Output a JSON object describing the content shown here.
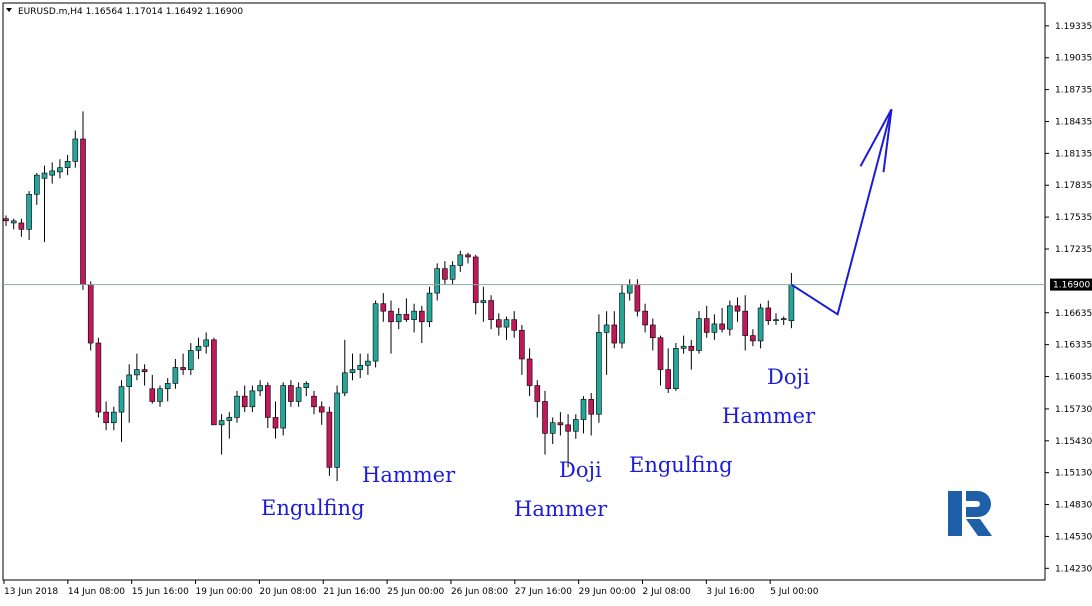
{
  "symbol_info": "EURUSD.m,H4  1.16564 1.17014 1.16492 1.16900",
  "current_price_label": "1.16900",
  "colors": {
    "bull": "#26a69a",
    "bear": "#c2185b",
    "line": "#1c1cd8",
    "logo": "#1f5fa8"
  },
  "logo_icon": "roboforex-logo-icon",
  "chart_data": {
    "type": "candlestick",
    "title": "EURUSD.m,H4",
    "xlabel": "",
    "ylabel": "",
    "ylim": [
      1.1412,
      1.1955
    ],
    "current_price": 1.169,
    "y_ticks": [
      "1.19335",
      "1.19035",
      "1.18735",
      "1.18435",
      "1.18135",
      "1.17835",
      "1.17535",
      "1.17235",
      "1.16635",
      "1.16335",
      "1.16035",
      "1.15730",
      "1.15430",
      "1.15130",
      "1.14830",
      "1.14530",
      "1.14230"
    ],
    "x_ticks": [
      "13 Jun 2018",
      "14 Jun 08:00",
      "15 Jun 16:00",
      "19 Jun 00:00",
      "20 Jun 08:00",
      "21 Jun 16:00",
      "25 Jun 00:00",
      "26 Jun 08:00",
      "27 Jun 16:00",
      "29 Jun 00:00",
      "2 Jul 08:00",
      "3 Jul 16:00",
      "5 Jul 00:00"
    ],
    "candles": [
      {
        "o": 1.1752,
        "h": 1.1755,
        "l": 1.1745,
        "c": 1.175
      },
      {
        "o": 1.1748,
        "h": 1.1752,
        "l": 1.1742,
        "c": 1.175
      },
      {
        "o": 1.1748,
        "h": 1.1752,
        "l": 1.1735,
        "c": 1.1742
      },
      {
        "o": 1.1742,
        "h": 1.1778,
        "l": 1.1732,
        "c": 1.1775
      },
      {
        "o": 1.1775,
        "h": 1.1795,
        "l": 1.1765,
        "c": 1.1793
      },
      {
        "o": 1.179,
        "h": 1.1802,
        "l": 1.173,
        "c": 1.1795
      },
      {
        "o": 1.1793,
        "h": 1.1805,
        "l": 1.1785,
        "c": 1.1797
      },
      {
        "o": 1.1796,
        "h": 1.1808,
        "l": 1.179,
        "c": 1.18
      },
      {
        "o": 1.18,
        "h": 1.1812,
        "l": 1.1793,
        "c": 1.1806
      },
      {
        "o": 1.1806,
        "h": 1.1835,
        "l": 1.18,
        "c": 1.1827
      },
      {
        "o": 1.1827,
        "h": 1.1853,
        "l": 1.1685,
        "c": 1.169
      },
      {
        "o": 1.169,
        "h": 1.1693,
        "l": 1.1628,
        "c": 1.1635
      },
      {
        "o": 1.1635,
        "h": 1.164,
        "l": 1.1565,
        "c": 1.157
      },
      {
        "o": 1.157,
        "h": 1.158,
        "l": 1.1553,
        "c": 1.156
      },
      {
        "o": 1.156,
        "h": 1.1575,
        "l": 1.1553,
        "c": 1.157
      },
      {
        "o": 1.157,
        "h": 1.16,
        "l": 1.1542,
        "c": 1.1594
      },
      {
        "o": 1.1594,
        "h": 1.1615,
        "l": 1.156,
        "c": 1.1605
      },
      {
        "o": 1.1605,
        "h": 1.1625,
        "l": 1.16,
        "c": 1.161
      },
      {
        "o": 1.161,
        "h": 1.1615,
        "l": 1.1595,
        "c": 1.1608
      },
      {
        "o": 1.1592,
        "h": 1.1605,
        "l": 1.1578,
        "c": 1.158
      },
      {
        "o": 1.158,
        "h": 1.1595,
        "l": 1.1575,
        "c": 1.1592
      },
      {
        "o": 1.1592,
        "h": 1.1602,
        "l": 1.158,
        "c": 1.1597
      },
      {
        "o": 1.1597,
        "h": 1.162,
        "l": 1.1592,
        "c": 1.1612
      },
      {
        "o": 1.1612,
        "h": 1.1625,
        "l": 1.1605,
        "c": 1.161
      },
      {
        "o": 1.161,
        "h": 1.1635,
        "l": 1.1605,
        "c": 1.1628
      },
      {
        "o": 1.1628,
        "h": 1.164,
        "l": 1.162,
        "c": 1.1632
      },
      {
        "o": 1.1632,
        "h": 1.1645,
        "l": 1.1625,
        "c": 1.1638
      },
      {
        "o": 1.1638,
        "h": 1.164,
        "l": 1.1565,
        "c": 1.1558
      },
      {
        "o": 1.1558,
        "h": 1.1568,
        "l": 1.153,
        "c": 1.1562
      },
      {
        "o": 1.1562,
        "h": 1.157,
        "l": 1.1545,
        "c": 1.1565
      },
      {
        "o": 1.1565,
        "h": 1.159,
        "l": 1.156,
        "c": 1.1585
      },
      {
        "o": 1.1585,
        "h": 1.1595,
        "l": 1.157,
        "c": 1.1575
      },
      {
        "o": 1.1575,
        "h": 1.1595,
        "l": 1.157,
        "c": 1.159
      },
      {
        "o": 1.159,
        "h": 1.16,
        "l": 1.1585,
        "c": 1.1595
      },
      {
        "o": 1.1595,
        "h": 1.1598,
        "l": 1.1555,
        "c": 1.1565
      },
      {
        "o": 1.1565,
        "h": 1.158,
        "l": 1.1545,
        "c": 1.1555
      },
      {
        "o": 1.1555,
        "h": 1.1598,
        "l": 1.1548,
        "c": 1.1595
      },
      {
        "o": 1.1595,
        "h": 1.16,
        "l": 1.1575,
        "c": 1.158
      },
      {
        "o": 1.158,
        "h": 1.1598,
        "l": 1.1575,
        "c": 1.1593
      },
      {
        "o": 1.1593,
        "h": 1.1599,
        "l": 1.1585,
        "c": 1.1597
      },
      {
        "o": 1.1585,
        "h": 1.159,
        "l": 1.1568,
        "c": 1.1575
      },
      {
        "o": 1.1575,
        "h": 1.158,
        "l": 1.1558,
        "c": 1.157
      },
      {
        "o": 1.157,
        "h": 1.1575,
        "l": 1.151,
        "c": 1.1518
      },
      {
        "o": 1.1518,
        "h": 1.1595,
        "l": 1.1505,
        "c": 1.1588
      },
      {
        "o": 1.1588,
        "h": 1.1638,
        "l": 1.1585,
        "c": 1.1607
      },
      {
        "o": 1.1607,
        "h": 1.1625,
        "l": 1.16,
        "c": 1.161
      },
      {
        "o": 1.161,
        "h": 1.1625,
        "l": 1.1602,
        "c": 1.1614
      },
      {
        "o": 1.1614,
        "h": 1.1625,
        "l": 1.1605,
        "c": 1.1618
      },
      {
        "o": 1.1618,
        "h": 1.1675,
        "l": 1.1612,
        "c": 1.1672
      },
      {
        "o": 1.1672,
        "h": 1.1682,
        "l": 1.1655,
        "c": 1.1665
      },
      {
        "o": 1.1665,
        "h": 1.1675,
        "l": 1.1625,
        "c": 1.1655
      },
      {
        "o": 1.1655,
        "h": 1.1668,
        "l": 1.1648,
        "c": 1.1662
      },
      {
        "o": 1.1662,
        "h": 1.1677,
        "l": 1.1655,
        "c": 1.1657
      },
      {
        "o": 1.1657,
        "h": 1.1672,
        "l": 1.1645,
        "c": 1.1665
      },
      {
        "o": 1.1665,
        "h": 1.167,
        "l": 1.1635,
        "c": 1.1655
      },
      {
        "o": 1.1655,
        "h": 1.1688,
        "l": 1.165,
        "c": 1.1682
      },
      {
        "o": 1.1682,
        "h": 1.171,
        "l": 1.1675,
        "c": 1.1705
      },
      {
        "o": 1.1705,
        "h": 1.1712,
        "l": 1.169,
        "c": 1.1695
      },
      {
        "o": 1.1695,
        "h": 1.1712,
        "l": 1.169,
        "c": 1.1708
      },
      {
        "o": 1.1708,
        "h": 1.1722,
        "l": 1.1702,
        "c": 1.1718
      },
      {
        "o": 1.1718,
        "h": 1.172,
        "l": 1.171,
        "c": 1.1716
      },
      {
        "o": 1.1716,
        "h": 1.1718,
        "l": 1.1662,
        "c": 1.1673
      },
      {
        "o": 1.1673,
        "h": 1.1688,
        "l": 1.1655,
        "c": 1.1675
      },
      {
        "o": 1.1675,
        "h": 1.168,
        "l": 1.1648,
        "c": 1.1657
      },
      {
        "o": 1.1657,
        "h": 1.1663,
        "l": 1.1642,
        "c": 1.165
      },
      {
        "o": 1.165,
        "h": 1.166,
        "l": 1.1638,
        "c": 1.1657
      },
      {
        "o": 1.1657,
        "h": 1.1665,
        "l": 1.164,
        "c": 1.1647
      },
      {
        "o": 1.1647,
        "h": 1.1652,
        "l": 1.1605,
        "c": 1.162
      },
      {
        "o": 1.162,
        "h": 1.163,
        "l": 1.1585,
        "c": 1.1595
      },
      {
        "o": 1.1595,
        "h": 1.16,
        "l": 1.1565,
        "c": 1.158
      },
      {
        "o": 1.158,
        "h": 1.159,
        "l": 1.153,
        "c": 1.155
      },
      {
        "o": 1.155,
        "h": 1.1565,
        "l": 1.154,
        "c": 1.156
      },
      {
        "o": 1.156,
        "h": 1.157,
        "l": 1.1548,
        "c": 1.1558
      },
      {
        "o": 1.1558,
        "h": 1.1568,
        "l": 1.1518,
        "c": 1.1552
      },
      {
        "o": 1.1552,
        "h": 1.1568,
        "l": 1.1545,
        "c": 1.1563
      },
      {
        "o": 1.1563,
        "h": 1.1585,
        "l": 1.155,
        "c": 1.1582
      },
      {
        "o": 1.1582,
        "h": 1.1588,
        "l": 1.1548,
        "c": 1.1568
      },
      {
        "o": 1.1568,
        "h": 1.1662,
        "l": 1.156,
        "c": 1.1645
      },
      {
        "o": 1.1645,
        "h": 1.1665,
        "l": 1.1605,
        "c": 1.1652
      },
      {
        "o": 1.1652,
        "h": 1.1665,
        "l": 1.163,
        "c": 1.1635
      },
      {
        "o": 1.1635,
        "h": 1.169,
        "l": 1.163,
        "c": 1.1682
      },
      {
        "o": 1.1682,
        "h": 1.1695,
        "l": 1.1675,
        "c": 1.169
      },
      {
        "o": 1.169,
        "h": 1.1695,
        "l": 1.166,
        "c": 1.1665
      },
      {
        "o": 1.1665,
        "h": 1.1672,
        "l": 1.1645,
        "c": 1.1652
      },
      {
        "o": 1.1652,
        "h": 1.1658,
        "l": 1.1628,
        "c": 1.164
      },
      {
        "o": 1.164,
        "h": 1.1642,
        "l": 1.1595,
        "c": 1.161
      },
      {
        "o": 1.161,
        "h": 1.163,
        "l": 1.1588,
        "c": 1.1592
      },
      {
        "o": 1.1592,
        "h": 1.1635,
        "l": 1.159,
        "c": 1.163
      },
      {
        "o": 1.163,
        "h": 1.1642,
        "l": 1.1625,
        "c": 1.1632
      },
      {
        "o": 1.1632,
        "h": 1.1638,
        "l": 1.161,
        "c": 1.1628
      },
      {
        "o": 1.1628,
        "h": 1.1665,
        "l": 1.1625,
        "c": 1.1658
      },
      {
        "o": 1.1658,
        "h": 1.167,
        "l": 1.164,
        "c": 1.1645
      },
      {
        "o": 1.1645,
        "h": 1.1662,
        "l": 1.1638,
        "c": 1.1653
      },
      {
        "o": 1.1653,
        "h": 1.1668,
        "l": 1.1645,
        "c": 1.1648
      },
      {
        "o": 1.1648,
        "h": 1.1675,
        "l": 1.1642,
        "c": 1.167
      },
      {
        "o": 1.167,
        "h": 1.1678,
        "l": 1.1655,
        "c": 1.1665
      },
      {
        "o": 1.1665,
        "h": 1.168,
        "l": 1.1628,
        "c": 1.1642
      },
      {
        "o": 1.1642,
        "h": 1.1648,
        "l": 1.1632,
        "c": 1.1637
      },
      {
        "o": 1.1637,
        "h": 1.1672,
        "l": 1.163,
        "c": 1.1668
      },
      {
        "o": 1.1668,
        "h": 1.1675,
        "l": 1.1652,
        "c": 1.1656
      },
      {
        "o": 1.1656,
        "h": 1.1663,
        "l": 1.1652,
        "c": 1.1657
      },
      {
        "o": 1.1657,
        "h": 1.166,
        "l": 1.1652,
        "c": 1.1658
      },
      {
        "o": 1.1656,
        "h": 1.1701,
        "l": 1.1649,
        "c": 1.169
      }
    ],
    "forecast_path": [
      [
        102,
        1.169
      ],
      [
        108,
        1.1662
      ],
      [
        115,
        1.1855
      ]
    ],
    "annotations": [
      "Engulfing",
      "Hammer",
      "Hammer",
      "Doji",
      "Engulfing",
      "Hammer",
      "Doji"
    ]
  }
}
